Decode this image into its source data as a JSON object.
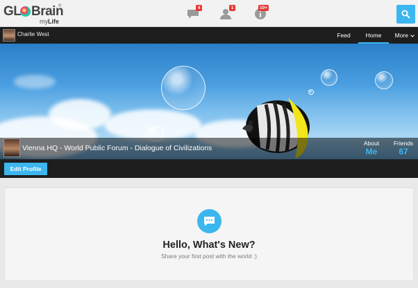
{
  "brand": {
    "logo_left": "GL",
    "logo_right": "Brain",
    "logo_reg": "®",
    "logo_sub_my": "my",
    "logo_sub_life": "Life"
  },
  "notifications": [
    {
      "icon": "chat-icon",
      "count": "4"
    },
    {
      "icon": "friend-request-icon",
      "count": "1"
    },
    {
      "icon": "info-icon",
      "count": "10+"
    }
  ],
  "search": {
    "icon": "search-icon"
  },
  "navbar": {
    "user_name": "Charlie West",
    "items": [
      {
        "label": "Feed"
      },
      {
        "label": "Home"
      },
      {
        "label": "More"
      }
    ]
  },
  "profile": {
    "title": "Vienna HQ - World Public Forum - Dialogue of Civilizations",
    "about_label": "About",
    "about_value": "Me",
    "friends_label": "Friends",
    "friends_value": "67",
    "edit_label": "Edit Profile"
  },
  "feed": {
    "heading": "Hello, What's New?",
    "subtext": "Share your first post with the world :)"
  },
  "colors": {
    "accent": "#3cb6ee",
    "badge": "#e53935",
    "dark_bar": "#1e1e1e"
  }
}
